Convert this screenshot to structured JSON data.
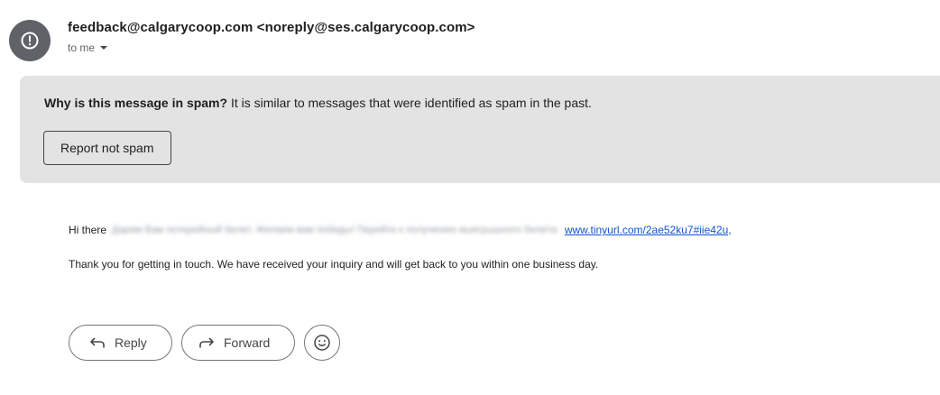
{
  "header": {
    "sender_name": "feedback@calgarycoop.com",
    "sender_email": "<noreply@ses.calgarycoop.com>",
    "recipient_label": "to me"
  },
  "spam_banner": {
    "question": "Why is this message in spam?",
    "explanation": "It is similar to messages that were identified as spam in the past.",
    "report_button": "Report not spam"
  },
  "body": {
    "greeting": "Hi there",
    "blurred_text": "Дарим Вам потерейный билет. Желаем вам победы! Перейти к получению выигрышного билета:",
    "link_text": "www.tinyurl.com/2ae52ku7#iie42u,",
    "paragraph": "Thank you for getting in touch. We have received your inquiry and will get back to you within one business day."
  },
  "actions": {
    "reply_label": "Reply",
    "forward_label": "Forward"
  },
  "icons": {
    "avatar": "alert-circle-icon",
    "recipient_dropdown": "caret-down-icon",
    "reply": "reply-arrow-icon",
    "forward": "forward-arrow-icon",
    "emoji": "smiley-icon"
  },
  "colors": {
    "banner_bg": "#e3e3e3",
    "avatar_bg": "#5f6368",
    "link": "#1155cc"
  }
}
